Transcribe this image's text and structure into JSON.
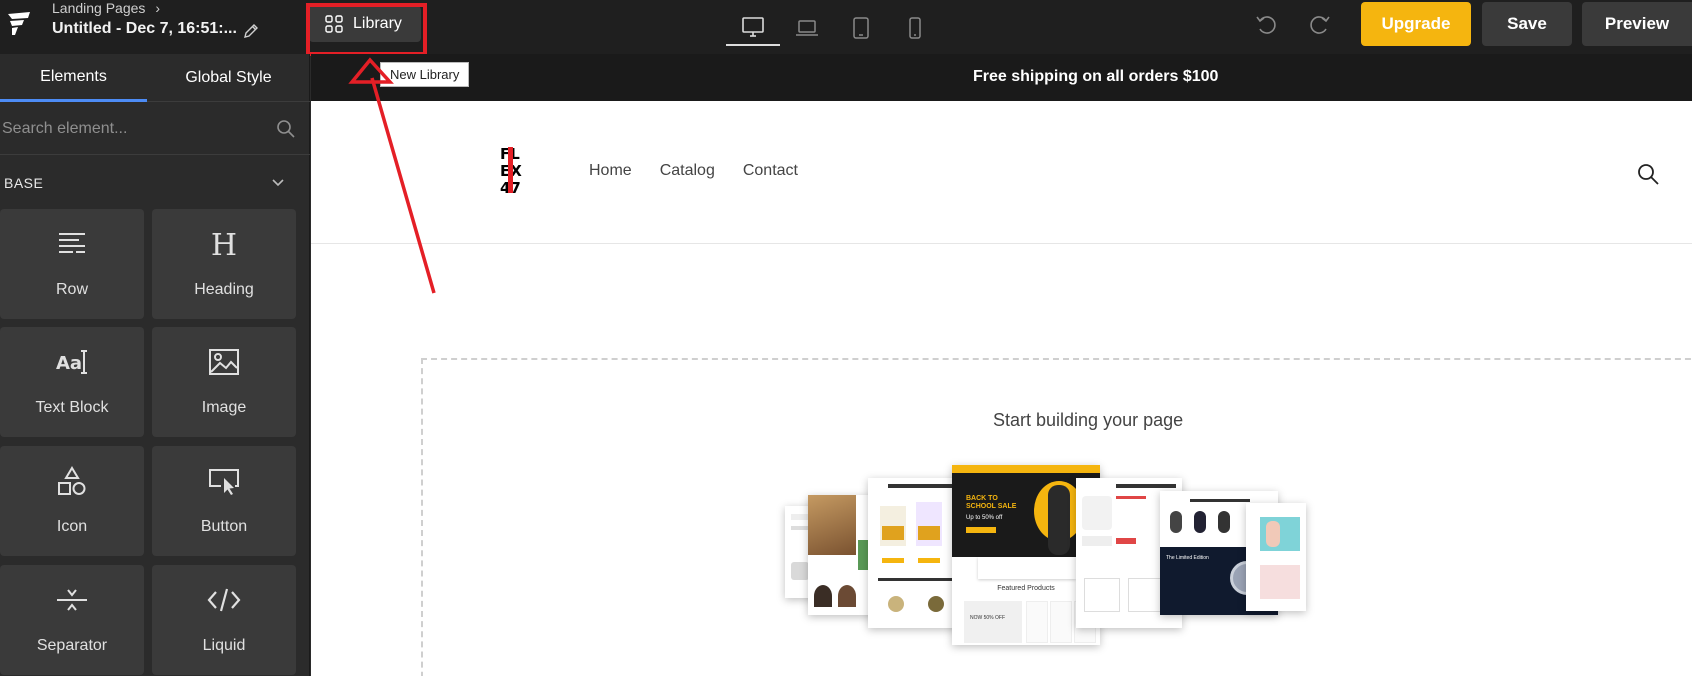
{
  "topbar": {
    "breadcrumb": "Landing Pages",
    "doc_title": "Untitled - Dec 7, 16:51:...",
    "library_label": "Library",
    "upgrade_label": "Upgrade",
    "save_label": "Save",
    "preview_label": "Preview",
    "devices": [
      "desktop",
      "laptop",
      "tablet",
      "mobile"
    ],
    "active_device": "desktop"
  },
  "tooltip": "New Library",
  "sidebar": {
    "tabs": [
      "Elements",
      "Global Style"
    ],
    "active_tab": "Elements",
    "search_placeholder": "Search element...",
    "section": "BASE",
    "elements": [
      {
        "label": "Row",
        "icon": "row-icon"
      },
      {
        "label": "Heading",
        "icon": "heading-icon"
      },
      {
        "label": "Text Block",
        "icon": "text-block-icon"
      },
      {
        "label": "Image",
        "icon": "image-icon"
      },
      {
        "label": "Icon",
        "icon": "shapes-icon"
      },
      {
        "label": "Button",
        "icon": "button-icon"
      },
      {
        "label": "Separator",
        "icon": "separator-icon"
      },
      {
        "label": "Liquid",
        "icon": "code-icon"
      }
    ]
  },
  "canvas": {
    "announcement": "Free shipping on all orders $100",
    "brand_letters": [
      "FL",
      "EX",
      "47"
    ],
    "nav": [
      "Home",
      "Catalog",
      "Contact"
    ],
    "empty_state": "Start building your page",
    "templates": {
      "sale_title": "BACK TO SCHOOL SALE",
      "sale_sub": "Up to 50% off",
      "featured": "Featured Products",
      "limited": "The Limited Edition",
      "lamp_promo": "NOW 50% OFF"
    }
  },
  "colors": {
    "accent": "#f5b50f",
    "highlight": "#e41f26",
    "tab_active": "#4d8cf5",
    "topbar_bg": "#1f1f1f",
    "sidebar_bg": "#2b2b2b"
  }
}
